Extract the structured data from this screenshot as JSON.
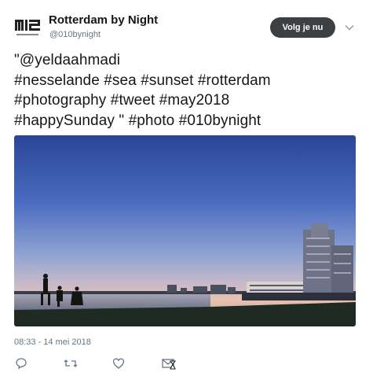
{
  "profile": {
    "display_name": "Rotterdam by Night",
    "handle": "@010bynight",
    "avatar_icon": "rotterdam-logo"
  },
  "follow_button": {
    "label": "Volg je nu"
  },
  "tweet": {
    "lines": [
      "\"@yeldaahmadi",
      "#nesselande #sea #sunset #rotterdam",
      "#photography #tweet #may2018",
      "#happySunday \" #photo #010bynight"
    ],
    "image_description_icon": "photo-city-sunset-skyline"
  },
  "meta": {
    "timestamp": "08:33 - 14 mei 2018"
  },
  "actions": {
    "reply_icon": "comment-icon",
    "retweet_icon": "retweet-icon",
    "like_icon": "heart-icon",
    "message_icon": "envelope-icon"
  },
  "colors": {
    "follow_bg": "#3d4043",
    "handle_text": "#657786",
    "text": "#14171a"
  }
}
